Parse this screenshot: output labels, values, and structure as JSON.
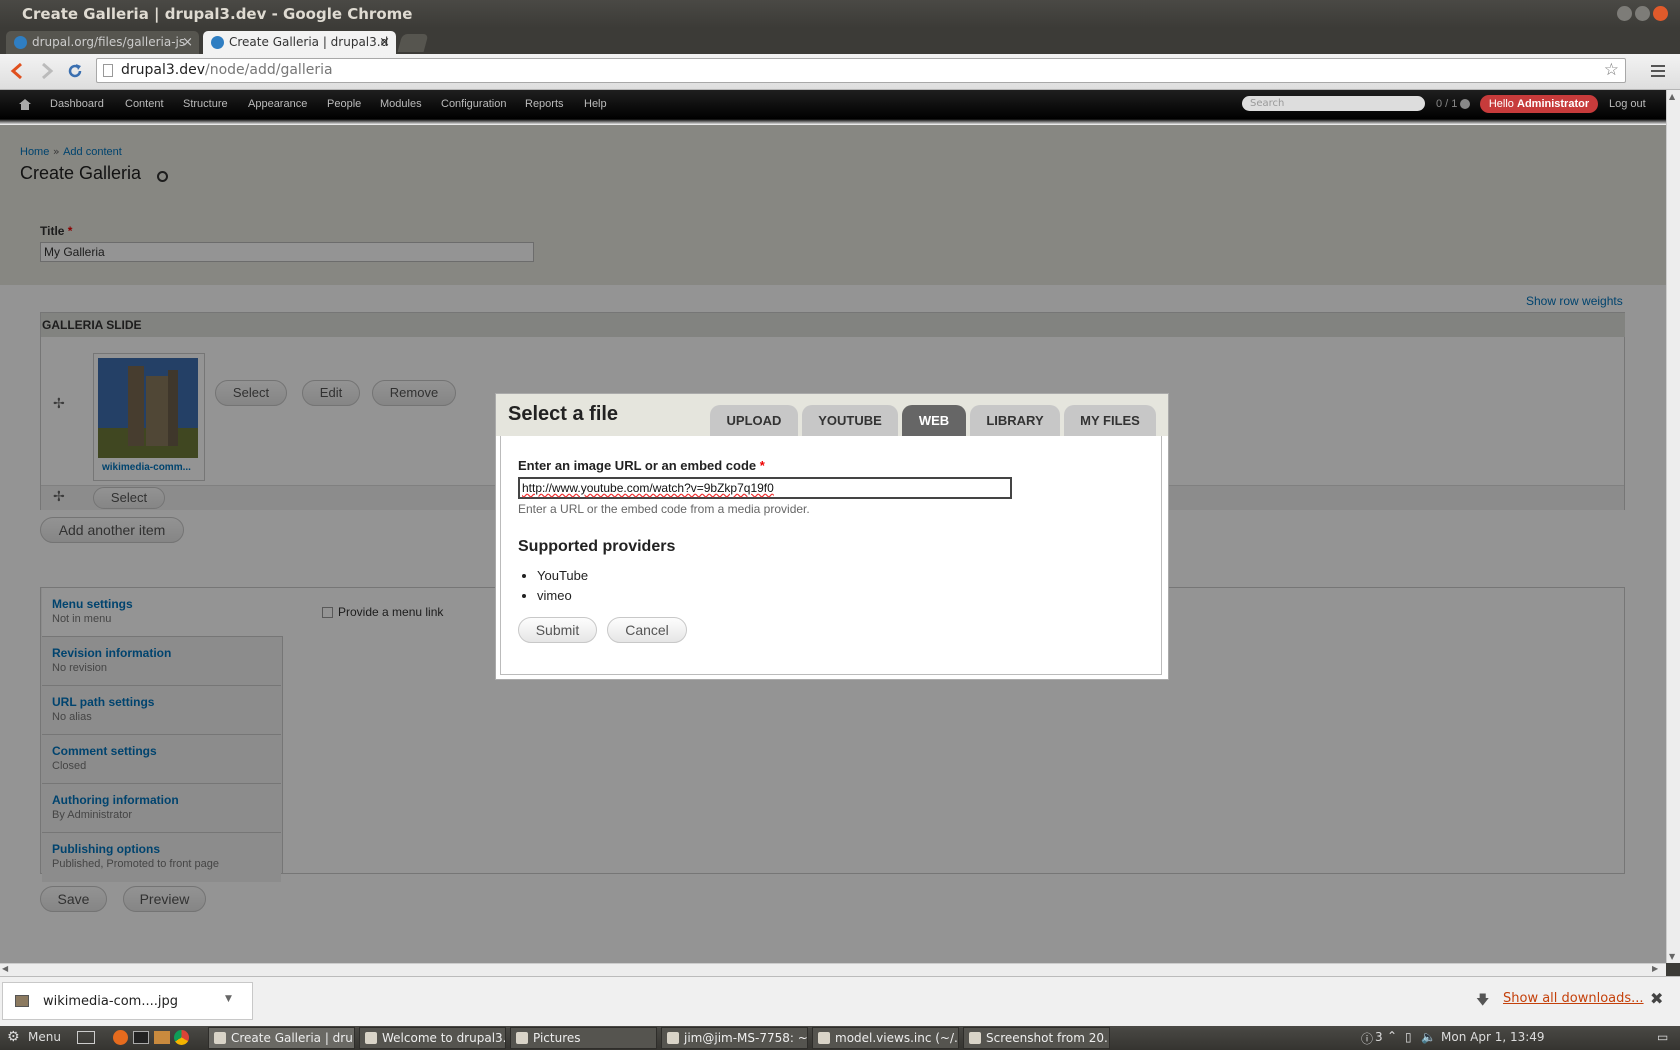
{
  "window": {
    "title": "Create Galleria | drupal3.dev - Google Chrome"
  },
  "tabs": [
    {
      "label": "drupal.org/files/galleria-js"
    },
    {
      "label": "Create Galleria | drupal3.d"
    }
  ],
  "address": {
    "host": "drupal3.dev",
    "path": "/node/add/galleria"
  },
  "adminbar": {
    "items": [
      "Dashboard",
      "Content",
      "Structure",
      "Appearance",
      "People",
      "Modules",
      "Configuration",
      "Reports",
      "Help"
    ],
    "search_placeholder": "Search",
    "counter": "0 / 1",
    "hello": "Hello",
    "user": "Administrator",
    "logout": "Log out"
  },
  "page": {
    "breadcrumb_home": "Home",
    "breadcrumb_sep": "»",
    "breadcrumb_add": "Add content",
    "title": "Create Galleria",
    "title_label": "Title",
    "required_mark": "*",
    "title_value": "My Galleria",
    "show_row_weights": "Show row weights",
    "galleria_slide_header": "GALLERIA SLIDE",
    "thumb_caption": "wikimedia-comm...",
    "select": "Select",
    "edit": "Edit",
    "remove": "Remove",
    "add_another": "Add another item",
    "provide_menu_link": "Provide a menu link",
    "save": "Save",
    "preview": "Preview"
  },
  "vtabs": [
    {
      "title": "Menu settings",
      "summary": "Not in menu"
    },
    {
      "title": "Revision information",
      "summary": "No revision"
    },
    {
      "title": "URL path settings",
      "summary": "No alias"
    },
    {
      "title": "Comment settings",
      "summary": "Closed"
    },
    {
      "title": "Authoring information",
      "summary": "By Administrator"
    },
    {
      "title": "Publishing options",
      "summary": "Published, Promoted to front page"
    }
  ],
  "dialog": {
    "title": "Select a file",
    "tabs": [
      "UPLOAD",
      "YOUTUBE",
      "WEB",
      "LIBRARY",
      "MY FILES"
    ],
    "active_tab": "WEB",
    "field_label": "Enter an image URL or an embed code",
    "field_value": "http://www.youtube.com/watch?v=9bZkp7q19f0",
    "field_help": "Enter a URL or the embed code from a media provider.",
    "providers_heading": "Supported providers",
    "providers": [
      "YouTube",
      "vimeo"
    ],
    "submit": "Submit",
    "cancel": "Cancel"
  },
  "downloads": {
    "file": "wikimedia-com....jpg",
    "show_all": "Show all downloads..."
  },
  "taskbar": {
    "menu": "Menu",
    "tasks": [
      "Create Galleria | dru...",
      "Welcome to drupal3....",
      "Pictures",
      "jim@jim-MS-7758: ~...",
      "model.views.inc (~/...",
      "Screenshot from 20..."
    ],
    "tray_count": "3",
    "clock": "Mon Apr  1, 13:49"
  }
}
